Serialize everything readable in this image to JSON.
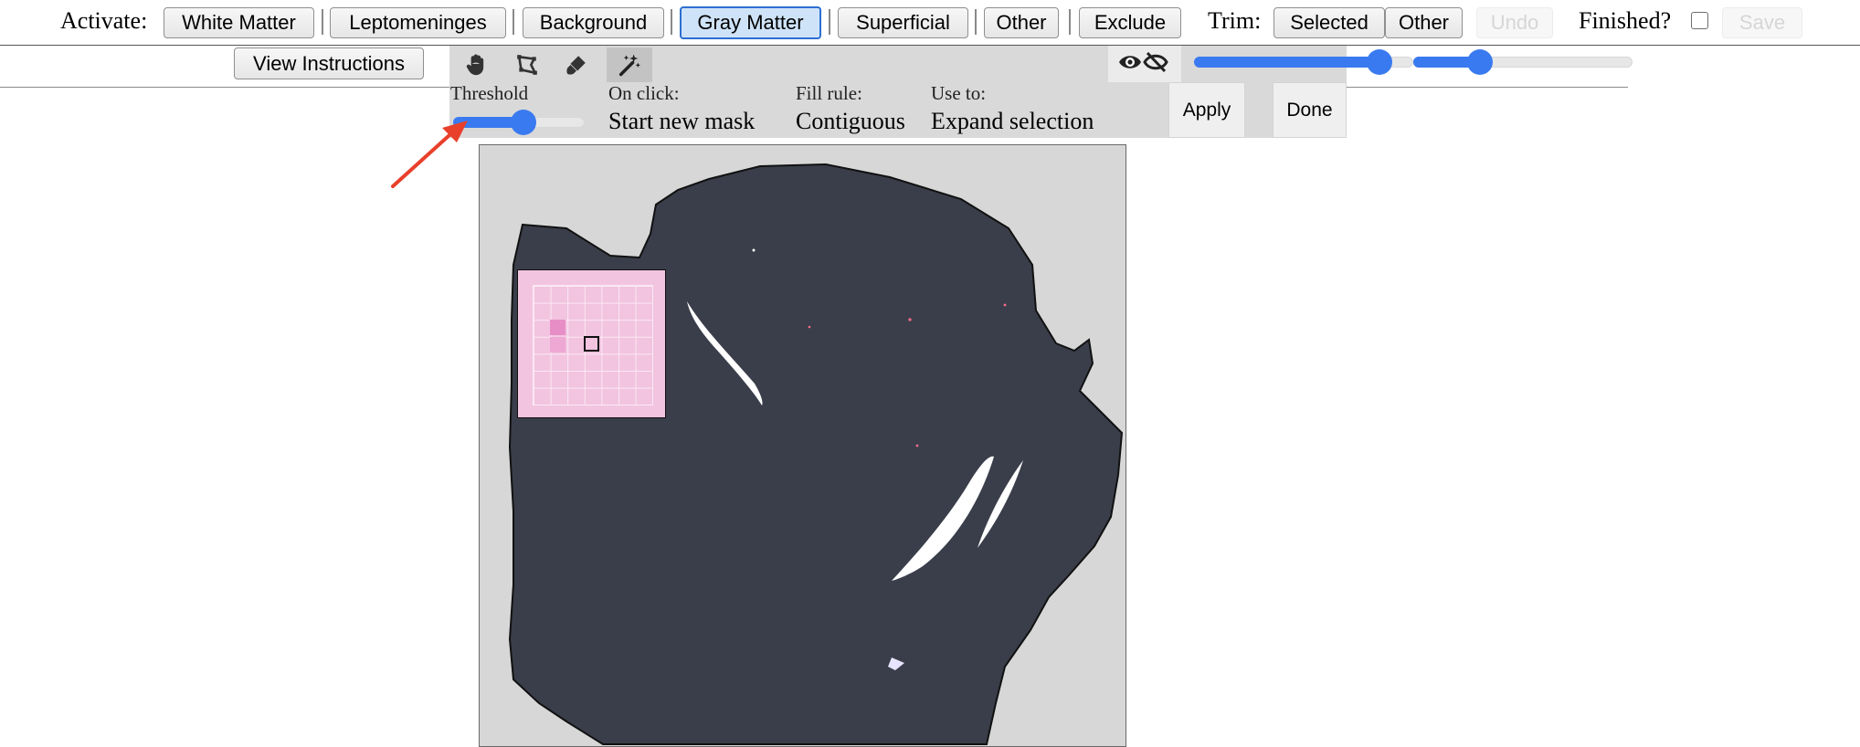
{
  "toolbar": {
    "activate_label": "Activate:",
    "buttons": [
      "White Matter",
      "Leptomeninges",
      "Background",
      "Gray Matter",
      "Superficial",
      "Other",
      "Exclude"
    ],
    "active_button": "Gray Matter",
    "trim_label": "Trim:",
    "trim_buttons": [
      "Selected",
      "Other"
    ],
    "undo_label": "Undo",
    "finished_label": "Finished?",
    "save_label": "Save"
  },
  "instructions_label": "View Instructions",
  "tools": [
    {
      "icon": "hand-pan-icon",
      "selected": false
    },
    {
      "icon": "polygon-lasso-icon",
      "selected": false
    },
    {
      "icon": "brush-icon",
      "selected": false
    },
    {
      "icon": "magic-wand-icon",
      "selected": true
    }
  ],
  "options": {
    "threshold_label": "Threshold",
    "threshold_value": 0.54,
    "onclick_label": "On click:",
    "onclick_value": "Start new mask",
    "fillrule_label": "Fill rule:",
    "fillrule_value": "Contiguous",
    "useto_label": "Use to:",
    "useto_value": "Expand selection",
    "apply_label": "Apply",
    "done_label": "Done"
  },
  "visibility_icon": "eye-toggle-icon",
  "sliders": {
    "opacity_1": 0.89,
    "opacity_2": 0.28
  },
  "colors": {
    "accent": "#3a7af0",
    "tissue": "#3a3e4a",
    "canvas_bg": "#d7d7d7",
    "magnifier": "#f2c4e0",
    "annotation_arrow": "#e8402b"
  }
}
